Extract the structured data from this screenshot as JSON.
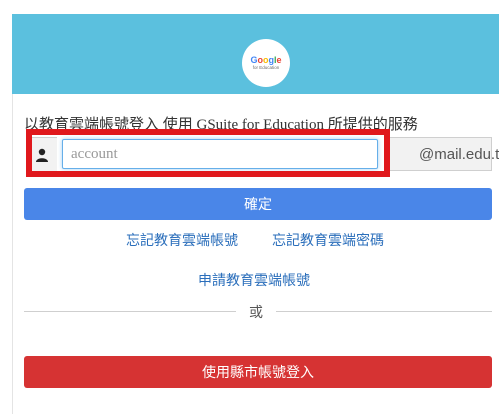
{
  "logo": {
    "brand": "Google",
    "sub": "for Education",
    "icon": "google-for-education-logo"
  },
  "description": "以教育雲端帳號登入 使用 GSuite for Education 所提供的服務",
  "login": {
    "user_icon": "user-icon",
    "account_placeholder": "account",
    "domain_suffix": "@mail.edu.tw"
  },
  "buttons": {
    "confirm": "確定",
    "county_login": "使用縣市帳號登入"
  },
  "links": {
    "forgot_account": "忘記教育雲端帳號",
    "forgot_password": "忘記教育雲端密碼",
    "apply_account": "申請教育雲端帳號"
  },
  "divider_text": "或",
  "colors": {
    "header": "#5bc0de",
    "confirm": "#4a86e8",
    "county": "#d63333",
    "highlight": "#e0181c",
    "link": "#2a6ebb"
  }
}
